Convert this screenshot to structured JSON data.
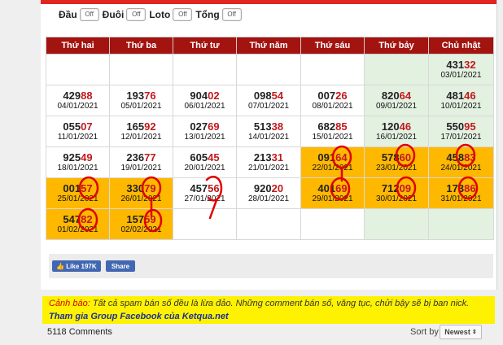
{
  "toggles": [
    {
      "label": "Đầu",
      "state": "Off"
    },
    {
      "label": "Đuôi",
      "state": "Off"
    },
    {
      "label": "Loto",
      "state": "Off"
    },
    {
      "label": "Tổng",
      "state": "Off"
    }
  ],
  "calendar": {
    "days": [
      "Thứ hai",
      "Thứ ba",
      "Thứ tư",
      "Thứ năm",
      "Thứ sáu",
      "Thứ bảy",
      "Chủ nhật"
    ],
    "rows": [
      [
        null,
        null,
        null,
        null,
        null,
        null,
        {
          "n": "431",
          "t": "32",
          "d": "03/01/2021"
        }
      ],
      [
        {
          "n": "429",
          "t": "88",
          "d": "04/01/2021"
        },
        {
          "n": "193",
          "t": "76",
          "d": "05/01/2021"
        },
        {
          "n": "904",
          "t": "02",
          "d": "06/01/2021"
        },
        {
          "n": "098",
          "t": "54",
          "d": "07/01/2021"
        },
        {
          "n": "007",
          "t": "26",
          "d": "08/01/2021"
        },
        {
          "n": "820",
          "t": "64",
          "d": "09/01/2021"
        },
        {
          "n": "481",
          "t": "46",
          "d": "10/01/2021"
        }
      ],
      [
        {
          "n": "055",
          "t": "07",
          "d": "11/01/2021"
        },
        {
          "n": "165",
          "t": "92",
          "d": "12/01/2021"
        },
        {
          "n": "027",
          "t": "69",
          "d": "13/01/2021"
        },
        {
          "n": "513",
          "t": "38",
          "d": "14/01/2021"
        },
        {
          "n": "682",
          "t": "85",
          "d": "15/01/2021"
        },
        {
          "n": "120",
          "t": "46",
          "d": "16/01/2021"
        },
        {
          "n": "550",
          "t": "95",
          "d": "17/01/2021"
        }
      ],
      [
        {
          "n": "925",
          "t": "49",
          "d": "18/01/2021"
        },
        {
          "n": "236",
          "t": "77",
          "d": "19/01/2021"
        },
        {
          "n": "605",
          "t": "45",
          "d": "20/01/2021"
        },
        {
          "n": "213",
          "t": "31",
          "d": "21/01/2021"
        },
        {
          "n": "091",
          "t": "64",
          "d": "22/01/2021",
          "hl": true
        },
        {
          "n": "578",
          "t": "60",
          "d": "23/01/2021",
          "hl": true
        },
        {
          "n": "458",
          "t": "83",
          "d": "24/01/2021",
          "hl": true
        }
      ],
      [
        {
          "n": "001",
          "t": "57",
          "d": "25/01/2021",
          "hl": true
        },
        {
          "n": "330",
          "t": "79",
          "d": "26/01/2021",
          "hl": true
        },
        {
          "n": "457",
          "t": "56",
          "d": "27/01/2021"
        },
        {
          "n": "920",
          "t": "20",
          "d": "28/01/2021"
        },
        {
          "n": "401",
          "t": "69",
          "d": "29/01/2021",
          "hl": true
        },
        {
          "n": "712",
          "t": "09",
          "d": "30/01/2021",
          "hl": true
        },
        {
          "n": "173",
          "t": "86",
          "d": "31/01/2021",
          "hl": true
        }
      ],
      [
        {
          "n": "547",
          "t": "82",
          "d": "01/02/2021",
          "hl": true
        },
        {
          "n": "157",
          "t": "59",
          "d": "02/02/2021",
          "hl": true
        },
        null,
        null,
        null,
        null,
        null
      ]
    ]
  },
  "social": {
    "like_label": "Like 197K",
    "share_label": "Share"
  },
  "warning": {
    "heading": "Cảnh báo:",
    "text": "Tất cả spam bán số đều là lừa đảo. Những comment bán số, văng tục, chửi bậy sẽ bị ban nick.",
    "link": "Tham gia Group Facebook của Ketqua.net"
  },
  "comments": {
    "count_label": "5118 Comments",
    "sort_label": "Sort by",
    "sort_value": "Newest"
  }
}
